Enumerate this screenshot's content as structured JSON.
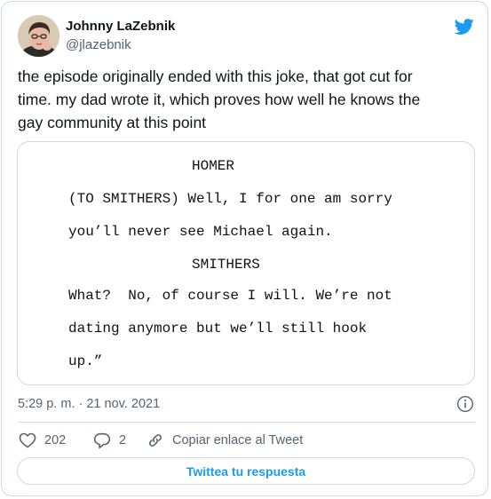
{
  "author": {
    "name": "Johnny LaZebnik",
    "handle": "@jlazebnik"
  },
  "tweet": {
    "text_lines": [
      "the episode originally ended with this joke, that got cut for",
      "time. my dad wrote it, which proves how well he knows the",
      "gay community at this point"
    ]
  },
  "script_image": {
    "lines": [
      "HOMER",
      "(TO SMITHERS) Well, I for one am sorry",
      "you’ll never see Michael again.",
      "SMITHERS",
      "What?  No, of course I will. We’re not",
      "dating anymore but we’ll still hook",
      "up.”"
    ]
  },
  "meta": {
    "timestamp": "5:29 p. m. · 21 nov. 2021"
  },
  "actions": {
    "likes": "202",
    "replies": "2",
    "copy_link_label": "Copiar enlace al Tweet"
  },
  "reply_button_label": "Twittea tu respuesta",
  "icons": {
    "brand": "twitter-bird-icon",
    "info": "info-icon",
    "like": "heart-icon",
    "reply": "speech-bubble-icon",
    "link": "link-icon"
  },
  "colors": {
    "twitter_blue": "#1d9bf0",
    "secondary_text": "#536471",
    "border": "#cfd9de"
  }
}
